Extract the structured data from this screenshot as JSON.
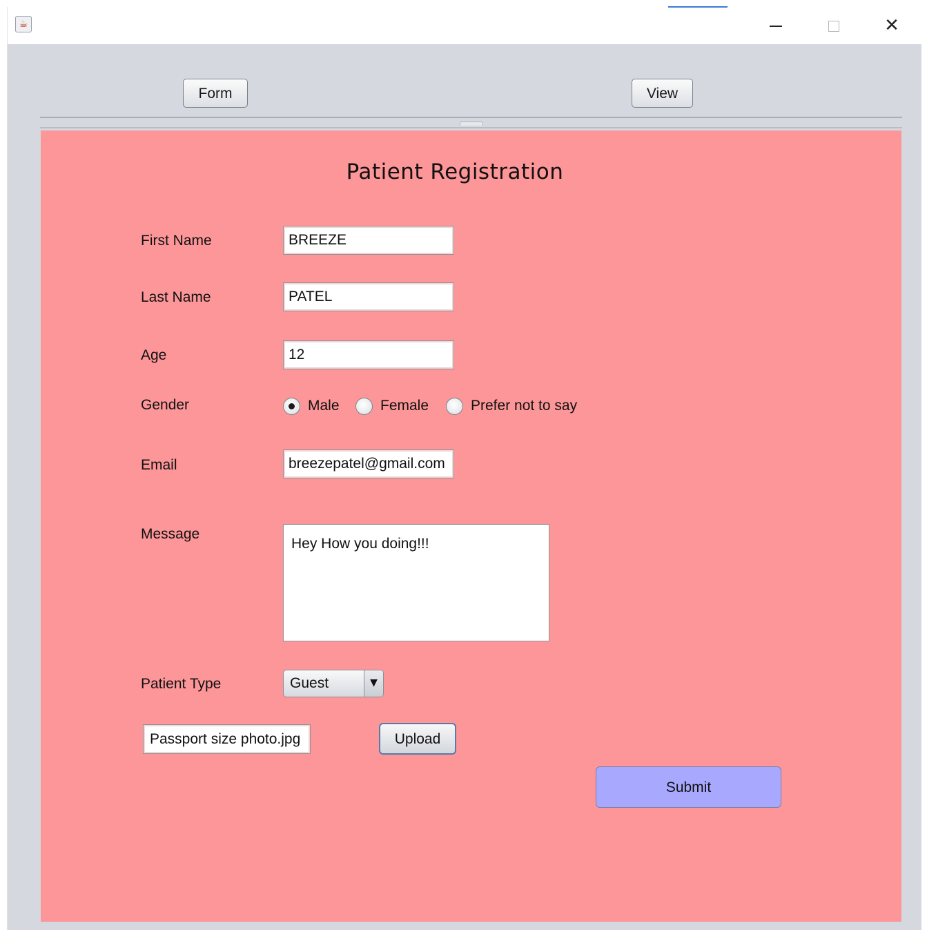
{
  "window": {
    "app_icon": "java-icon",
    "controls": {
      "minimize_icon": "minimize-icon",
      "maximize_icon": "maximize-icon",
      "close_icon": "close-icon",
      "close_glyph": "✕"
    }
  },
  "toolbar": {
    "form_label": "Form",
    "view_label": "View"
  },
  "form": {
    "title": "Patient Registration",
    "background_color": "#fd9698",
    "first_name": {
      "label": "First Name",
      "value": "BREEZE"
    },
    "last_name": {
      "label": "Last Name",
      "value": "PATEL"
    },
    "age": {
      "label": "Age",
      "value": "12"
    },
    "gender": {
      "label": "Gender",
      "options": [
        {
          "label": "Male",
          "checked": true
        },
        {
          "label": "Female",
          "checked": false
        },
        {
          "label": "Prefer not to say",
          "checked": false
        }
      ]
    },
    "email": {
      "label": "Email",
      "value": "breezepatel@gmail.com"
    },
    "message": {
      "label": "Message",
      "value": "Hey How you doing!!!"
    },
    "patient_type": {
      "label": "Patient Type",
      "selected": "Guest",
      "arrow": "▼"
    },
    "file": {
      "value": "Passport size photo.jpg"
    },
    "upload_label": "Upload",
    "submit_label": "Submit",
    "submit_color": "#a8a8ff"
  }
}
